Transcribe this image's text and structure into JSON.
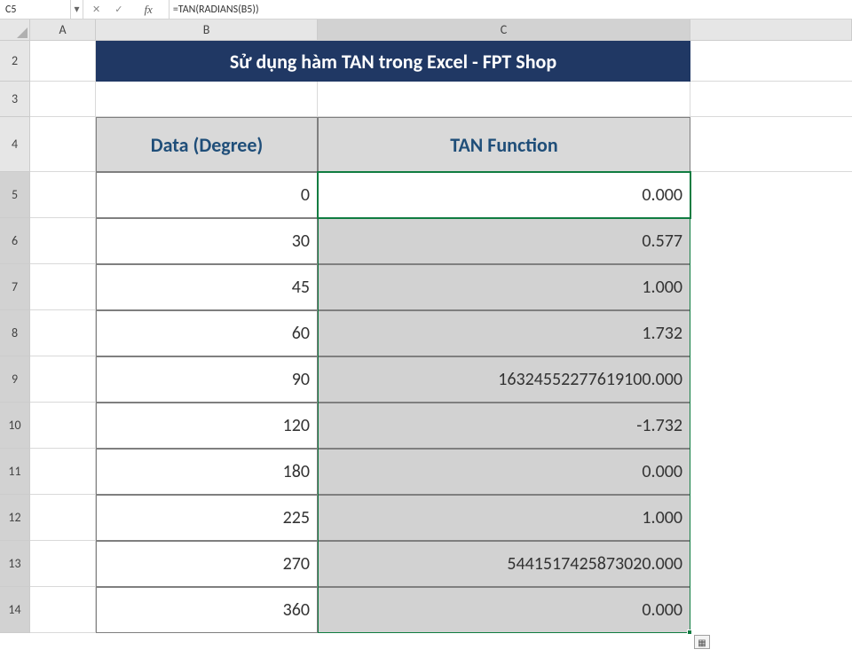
{
  "namebox": "C5",
  "formula": "=TAN(RADIANS(B5))",
  "col_headers": [
    "A",
    "B",
    "C"
  ],
  "row_headers": [
    "2",
    "3",
    "4",
    "5",
    "6",
    "7",
    "8",
    "9",
    "10",
    "11",
    "12",
    "13",
    "14"
  ],
  "title": "Sử dụng hàm TAN trong Excel - FPT Shop",
  "head_b": "Data (Degree)",
  "head_c": "TAN Function",
  "rows": [
    {
      "b": "0",
      "c": "0.000"
    },
    {
      "b": "30",
      "c": "0.577"
    },
    {
      "b": "45",
      "c": "1.000"
    },
    {
      "b": "60",
      "c": "1.732"
    },
    {
      "b": "90",
      "c": "16324552277619100.000"
    },
    {
      "b": "120",
      "c": "-1.732"
    },
    {
      "b": "180",
      "c": "0.000"
    },
    {
      "b": "225",
      "c": "1.000"
    },
    {
      "b": "270",
      "c": "5441517425873020.000"
    },
    {
      "b": "360",
      "c": "0.000"
    }
  ],
  "icons": {
    "cancel": "✕",
    "confirm": "✓",
    "fx": "fx",
    "dd": "▾"
  }
}
